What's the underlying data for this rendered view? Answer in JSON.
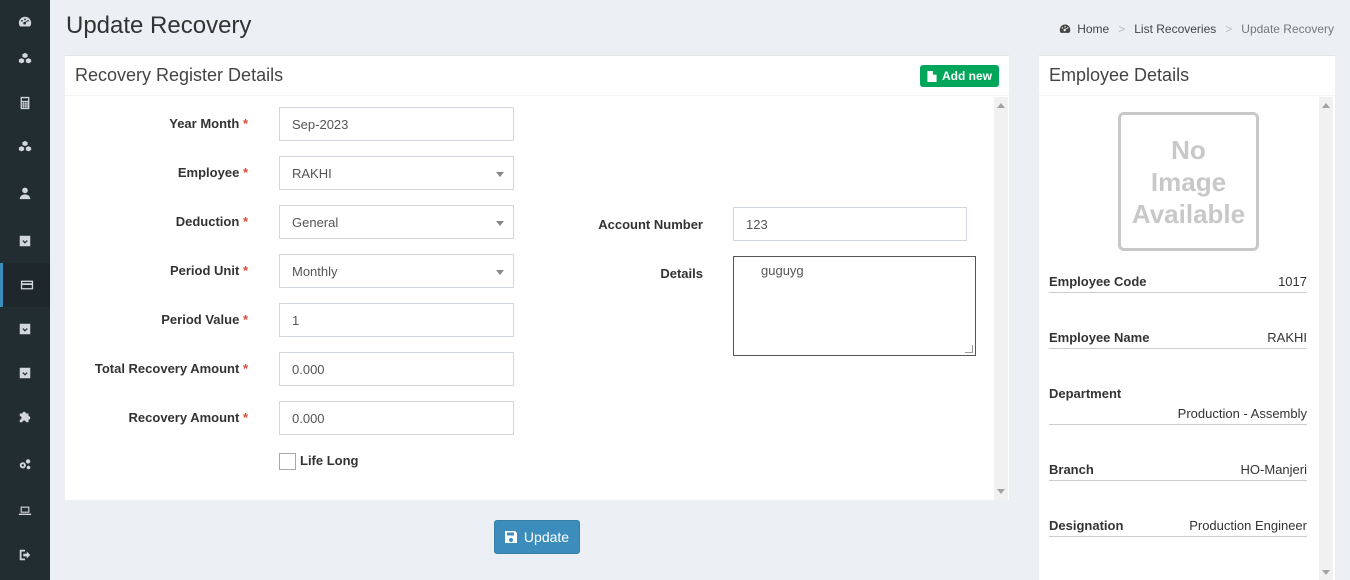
{
  "page": {
    "title": "Update Recovery"
  },
  "breadcrumb": {
    "home": "Home",
    "list": "List Recoveries",
    "current": "Update Recovery",
    "separator": ">"
  },
  "sidebar": {
    "items": [
      {
        "icon": "dashboard-icon"
      },
      {
        "icon": "cubes-icon"
      },
      {
        "icon": "calculator-icon"
      },
      {
        "icon": "cubes-icon"
      },
      {
        "icon": "user-icon"
      },
      {
        "icon": "download-icon"
      },
      {
        "icon": "credit-card-icon",
        "active": true
      },
      {
        "icon": "download-icon"
      },
      {
        "icon": "download-icon"
      },
      {
        "icon": "puzzle-icon"
      },
      {
        "icon": "cogs-icon"
      },
      {
        "icon": "laptop-icon"
      },
      {
        "icon": "sign-out-icon"
      }
    ]
  },
  "register": {
    "title": "Recovery Register Details",
    "add_new": "Add new",
    "required_mark": "*",
    "fields": {
      "year_month": {
        "label": "Year Month",
        "value": "Sep-2023"
      },
      "employee": {
        "label": "Employee",
        "value": "RAKHI"
      },
      "deduction": {
        "label": "Deduction",
        "value": "General"
      },
      "period_unit": {
        "label": "Period Unit",
        "value": "Monthly"
      },
      "period_value": {
        "label": "Period Value",
        "value": "1"
      },
      "total_recovery_amount": {
        "label": "Total Recovery Amount",
        "value": "0.000"
      },
      "recovery_amount": {
        "label": "Recovery Amount",
        "value": "0.000"
      },
      "life_long": {
        "label": "Life Long",
        "checked": false
      },
      "account_number": {
        "label": "Account Number",
        "value": "123"
      },
      "details": {
        "label": "Details",
        "value": "guguyg"
      }
    },
    "update_label": "Update"
  },
  "employee_details": {
    "title": "Employee Details",
    "no_image": [
      "No",
      "Image",
      "Available"
    ],
    "rows": [
      {
        "label": "Employee Code",
        "value": "1017"
      },
      {
        "label": "Employee Name",
        "value": "RAKHI"
      },
      {
        "label": "Department",
        "value": "Production - Assembly"
      },
      {
        "label": "Branch",
        "value": "HO-Manjeri"
      },
      {
        "label": "Designation",
        "value": "Production Engineer"
      }
    ]
  },
  "colors": {
    "sidebar_bg": "#222d32",
    "primary": "#3c8dbc",
    "success": "#00a65a",
    "required": "#dd4b39"
  }
}
